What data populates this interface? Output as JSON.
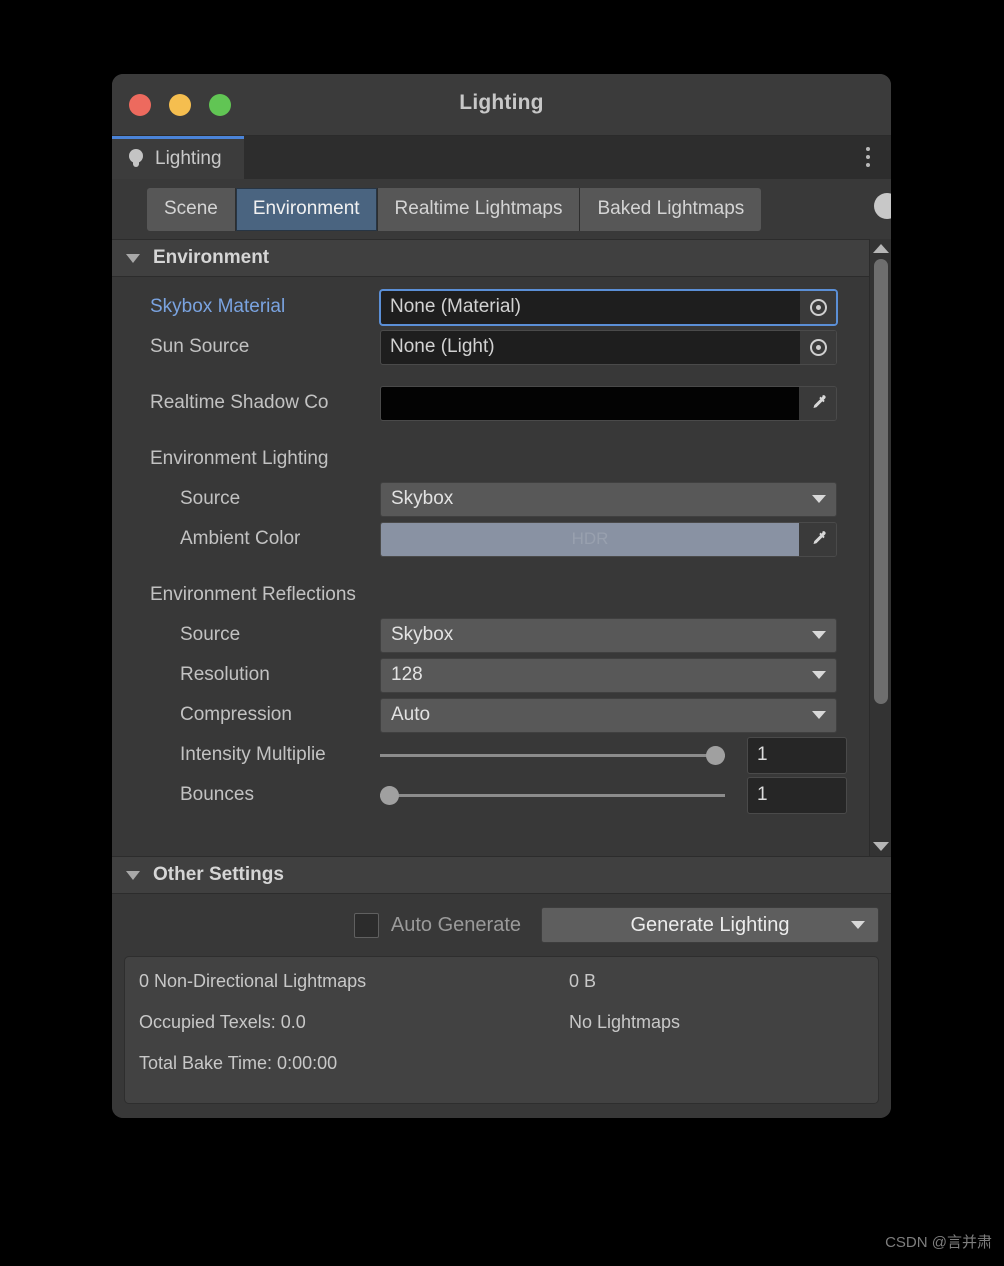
{
  "window": {
    "title": "Lighting",
    "traffic_lights": [
      {
        "name": "close",
        "color": "#ed6a5e"
      },
      {
        "name": "minimize",
        "color": "#f5be4f"
      },
      {
        "name": "maximize",
        "color": "#61c554"
      }
    ]
  },
  "editor_tab": {
    "label": "Lighting",
    "icon": "lightbulb-icon",
    "accent_color": "#4b84d8"
  },
  "menu": {
    "kebab_icon": "more-options-icon"
  },
  "section_tabs": {
    "selected": "Environment",
    "selected_color": "#4a6480",
    "items": [
      {
        "label": "Scene"
      },
      {
        "label": "Environment"
      },
      {
        "label": "Realtime Lightmaps"
      },
      {
        "label": "Baked Lightmaps"
      }
    ]
  },
  "environment": {
    "header": "Environment",
    "skybox_material": {
      "label": "Skybox Material",
      "value": "None (Material)",
      "label_color": "#7aa3e0",
      "focused": true
    },
    "sun_source": {
      "label": "Sun Source",
      "value": "None (Light)"
    },
    "realtime_shadow_color": {
      "label": "Realtime Shadow Co",
      "color": "#030303"
    },
    "environment_lighting": {
      "group_label": "Environment Lighting",
      "source": {
        "label": "Source",
        "value": "Skybox"
      },
      "ambient_color": {
        "label": "Ambient Color",
        "color": "#8992a3",
        "hdr_badge": "HDR"
      }
    },
    "environment_reflections": {
      "group_label": "Environment Reflections",
      "source": {
        "label": "Source",
        "value": "Skybox"
      },
      "resolution": {
        "label": "Resolution",
        "value": "128"
      },
      "compression": {
        "label": "Compression",
        "value": "Auto"
      },
      "intensity_multiplier": {
        "label": "Intensity Multiplie",
        "value": "1",
        "slider_percent": 100
      },
      "bounces": {
        "label": "Bounces",
        "value": "1",
        "slider_percent": 0
      }
    }
  },
  "other_settings": {
    "header": "Other Settings"
  },
  "generate": {
    "auto_generate_label": "Auto Generate",
    "auto_generate_checked": false,
    "button_label": "Generate Lighting"
  },
  "stats": {
    "left": [
      "0 Non-Directional Lightmaps",
      "",
      "Occupied Texels: 0.0",
      "Total Bake Time: 0:00:00"
    ],
    "right": [
      "0 B",
      "No Lightmaps"
    ]
  },
  "watermark": {
    "text": "CSDN @言并肃"
  }
}
